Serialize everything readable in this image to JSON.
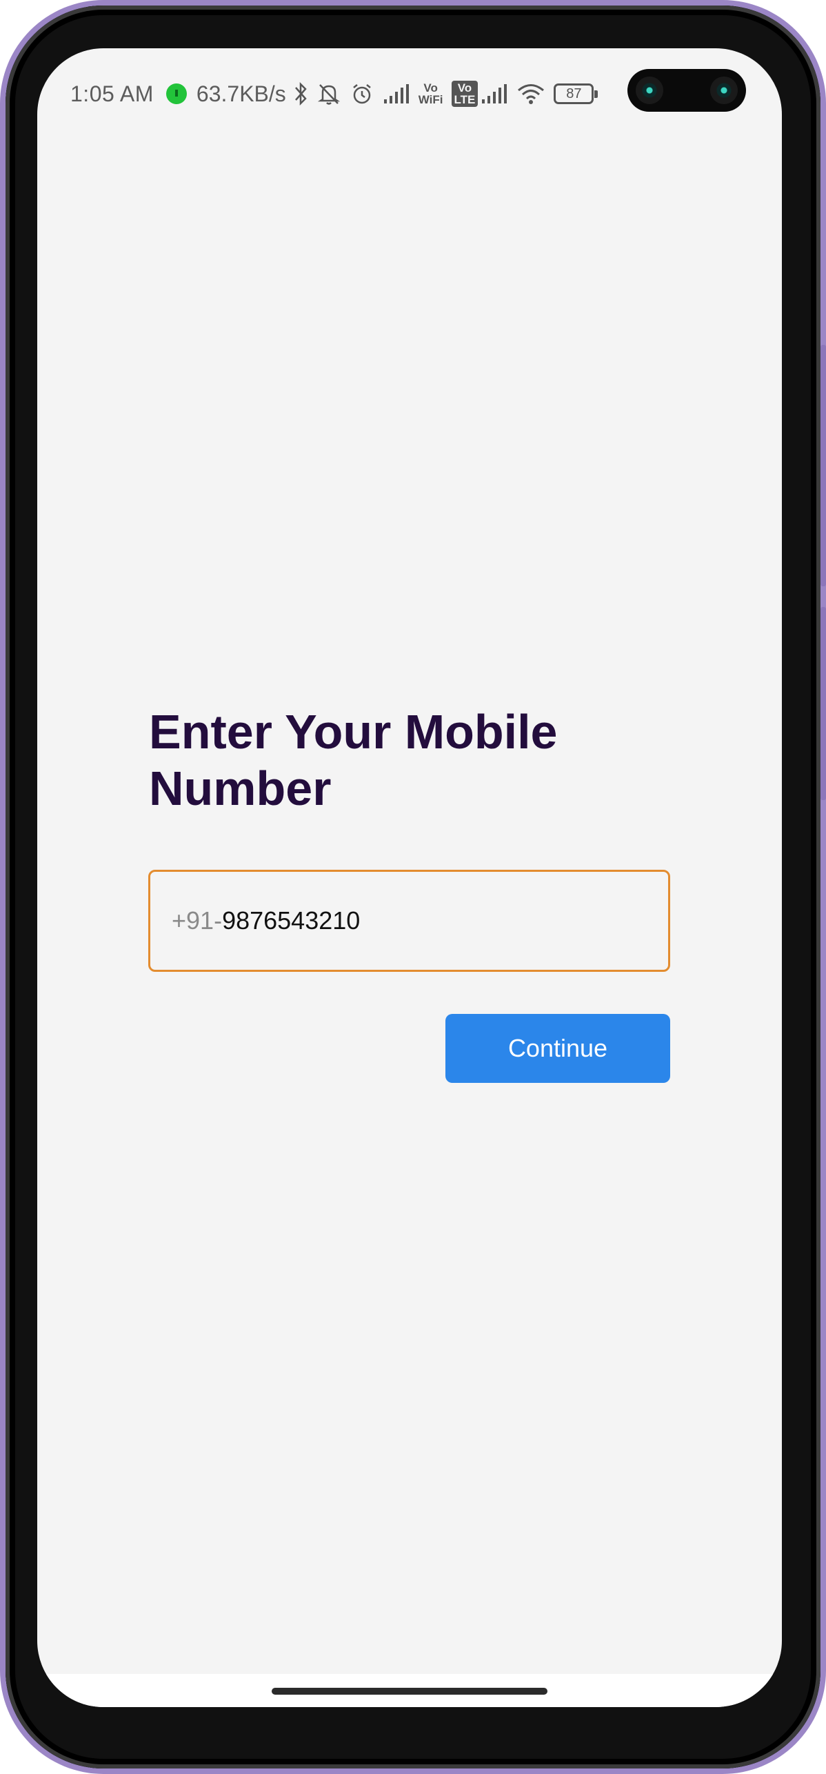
{
  "status_bar": {
    "time": "1:05 AM",
    "net_speed": "63.7KB/s",
    "icons": [
      "data-activity-icon",
      "bluetooth-icon",
      "mute-bell-icon",
      "alarm-icon",
      "signal-icon",
      "vowifi-icon",
      "volte-icon",
      "signal-icon",
      "wifi-icon"
    ],
    "vowifi_top": "Vo",
    "vowifi_bottom": "WiFi",
    "volte_top": "Vo",
    "volte_bottom": "LTE",
    "battery": "87"
  },
  "login": {
    "title": "Enter Your Mobile Number",
    "country_prefix": "+91-",
    "phone_value": "9876543210",
    "continue_label": "Continue"
  },
  "colors": {
    "title": "#230d3d",
    "field_border": "#e38c2f",
    "button_bg": "#2b86ea",
    "background": "#f4f4f4"
  }
}
